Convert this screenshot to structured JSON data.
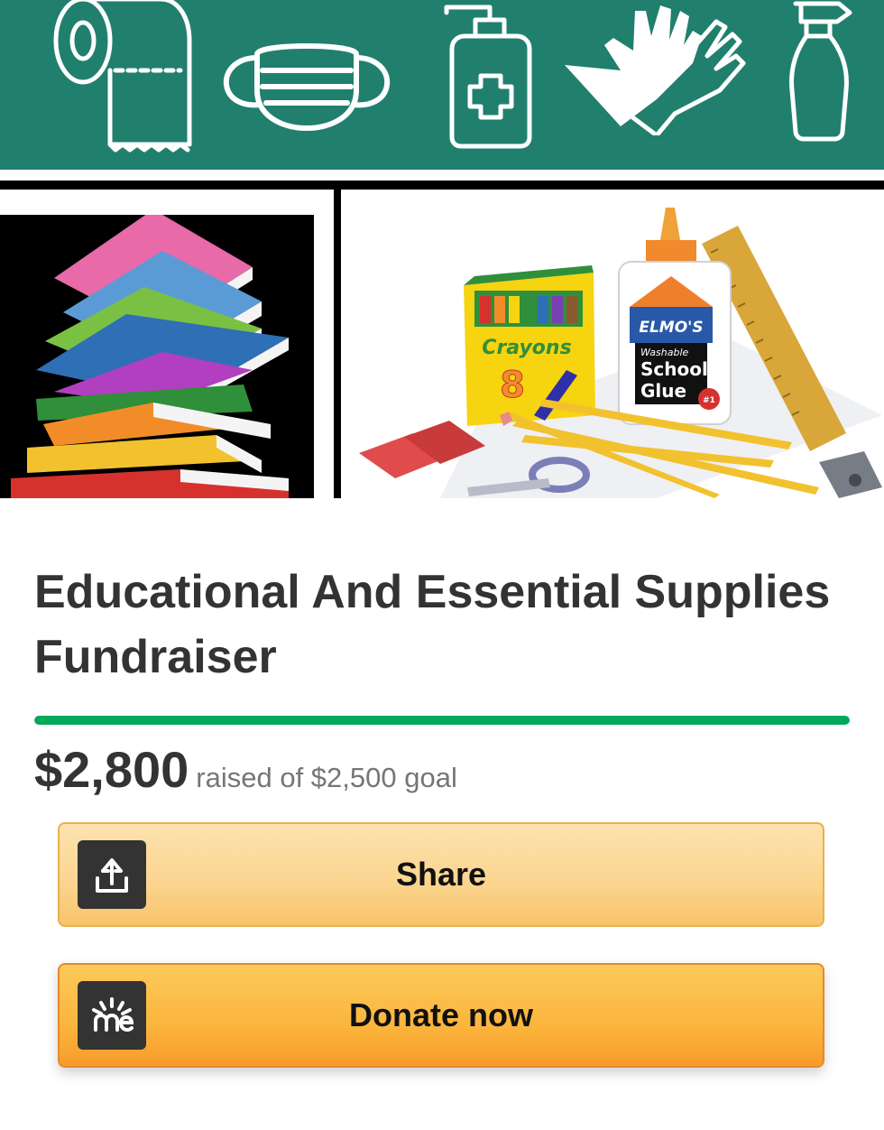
{
  "hero": {
    "crayons_box": {
      "brand": "Crayons",
      "count": "8"
    },
    "glue_bottle": {
      "brand": "ELMO'S",
      "line1": "Washable",
      "line2": "School",
      "line3": "Glue",
      "badge": "#1"
    },
    "icons": [
      "toilet-paper-icon",
      "face-mask-icon",
      "hand-sanitizer-icon",
      "gloves-icon",
      "spray-bottle-icon"
    ]
  },
  "campaign": {
    "title": "Educational And Essential Supplies Fundraiser",
    "amount_raised": "$2,800",
    "goal_text": "raised of $2,500 goal",
    "progress_fraction": 1.0
  },
  "actions": {
    "share_label": "Share",
    "donate_label": "Donate now"
  },
  "colors": {
    "teal": "#217f6e",
    "progress_green": "#02a95c",
    "text_dark": "#333333",
    "text_muted": "#767676",
    "share_bg": "#fbd48e",
    "donate_bg": "#fbb53d"
  }
}
